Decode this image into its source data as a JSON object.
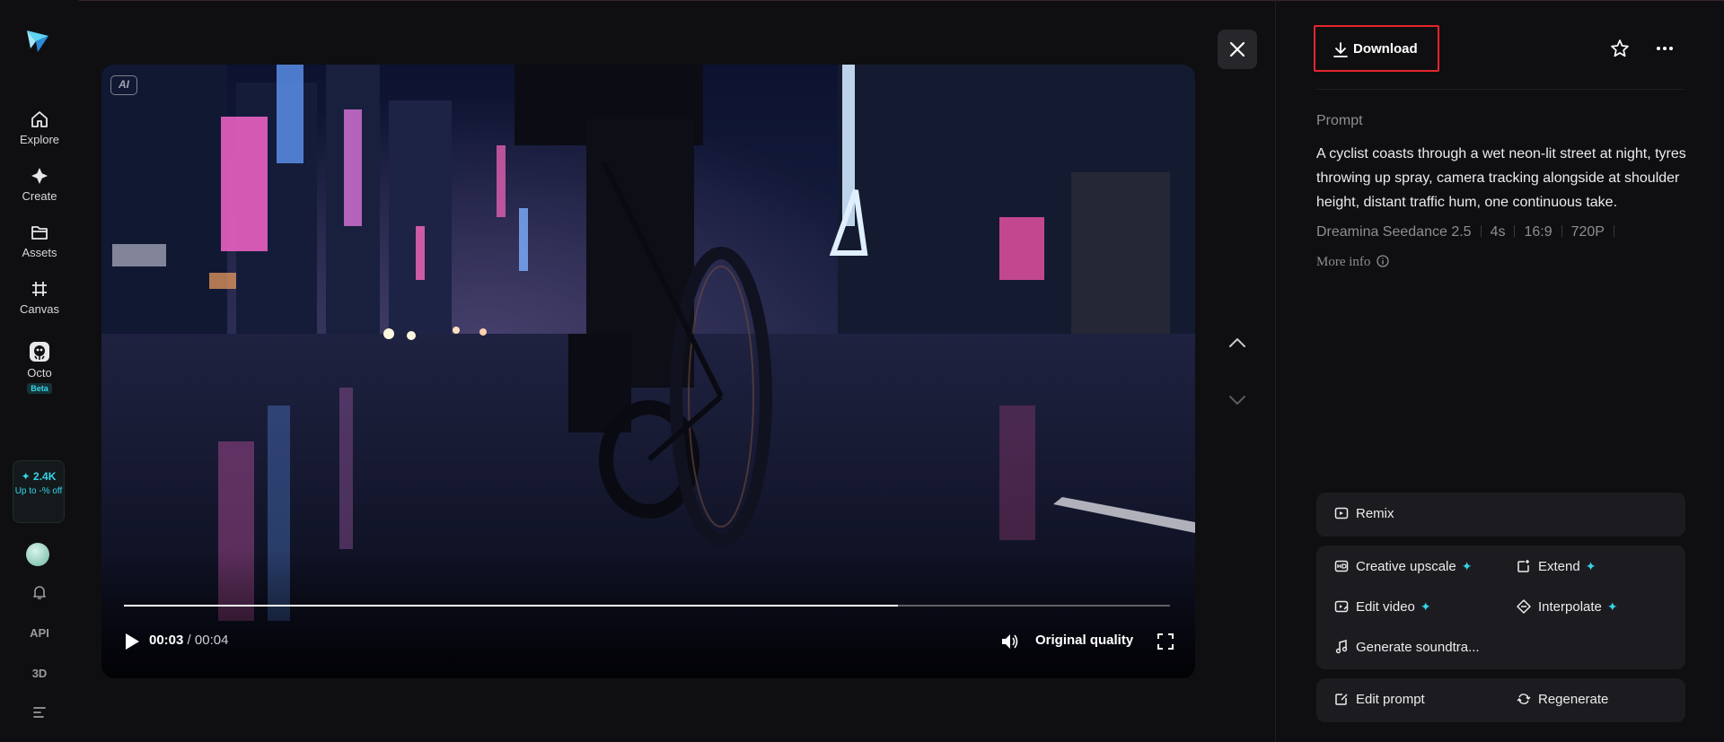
{
  "sidebar": {
    "nav": [
      {
        "label": "Explore",
        "icon": "home-icon"
      },
      {
        "label": "Create",
        "icon": "diamond-icon"
      },
      {
        "label": "Assets",
        "icon": "folder-icon"
      },
      {
        "label": "Canvas",
        "icon": "canvas-icon"
      },
      {
        "label": "Octo",
        "icon": "octo-icon",
        "badge": "Beta"
      }
    ],
    "promo": {
      "credits": "✦ 2.4K",
      "offer": "Up to -% off"
    },
    "bottom": {
      "api_label": "API",
      "threed_label": "3D"
    }
  },
  "player": {
    "ai_badge": "AI",
    "current_time": "00:03",
    "duration": "/ 00:04",
    "progress": 0.74,
    "quality_label": "Original quality"
  },
  "panel": {
    "download_label": "Download",
    "prompt_title": "Prompt",
    "prompt_text": "A cyclist coasts through a wet neon-lit street at night, tyres throwing up spray, camera tracking alongside at shoulder height, distant traffic hum, one continuous take.",
    "meta": {
      "model": "Dreamina Seedance 2.5",
      "duration": "4s",
      "ratio": "16:9",
      "resolution": "720P"
    },
    "more_info_label": "More info",
    "actions": {
      "remix": "Remix",
      "creative_upscale": "Creative upscale",
      "extend": "Extend",
      "edit_video": "Edit video",
      "interpolate": "Interpolate",
      "generate_soundtrack": "Generate soundtra...",
      "edit_prompt": "Edit prompt",
      "regenerate": "Regenerate"
    }
  },
  "colors": {
    "accent": "#35d4e8",
    "highlight_border": "#e5262d",
    "background": "#0f0f11",
    "panel": "#1c1c20"
  }
}
